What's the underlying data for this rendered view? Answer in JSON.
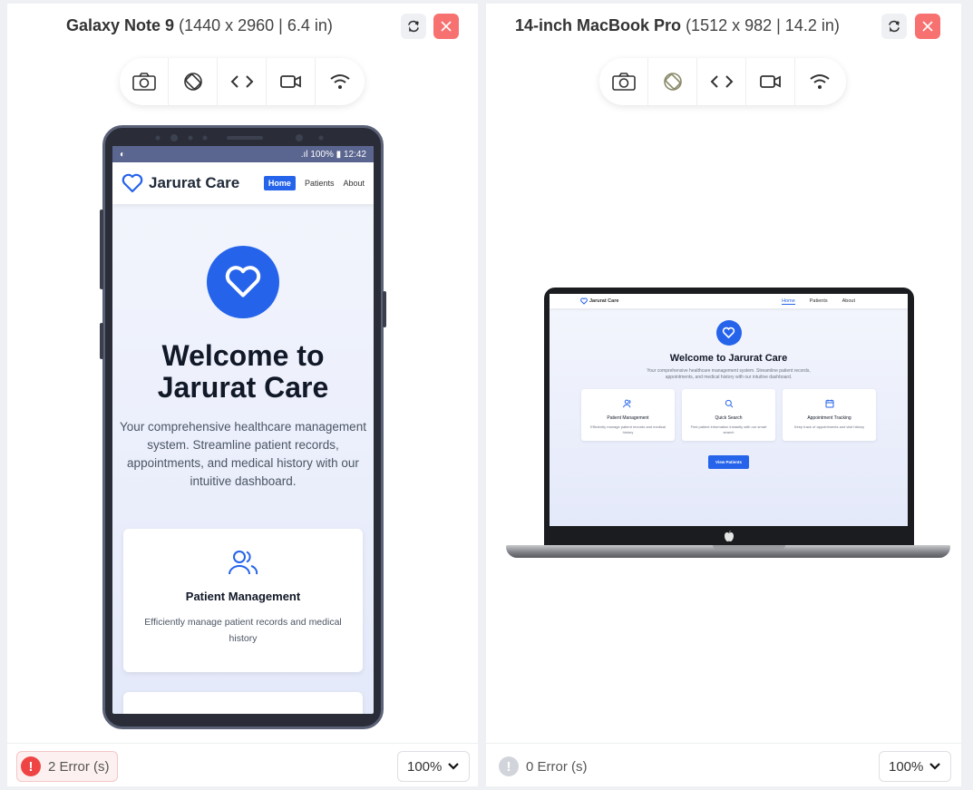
{
  "left_panel": {
    "device_name": "Galaxy Note 9",
    "device_spec": "(1440 x 2960 | 6.4 in)",
    "errors_label": "2 Error (s)",
    "zoom": "100%"
  },
  "right_panel": {
    "device_name": "14-inch MacBook Pro",
    "device_spec": "(1512 x 982 | 14.2 in)",
    "errors_label": "0 Error (s)",
    "zoom": "100%"
  },
  "toolbar_icons": [
    "camera-icon",
    "rotate-icon",
    "code-icon",
    "video-icon",
    "wifi-icon"
  ],
  "phone_status": {
    "battery": "100%",
    "time": "12:42"
  },
  "site": {
    "brand": "Jarurat Care",
    "nav": {
      "home": "Home",
      "patients": "Patients",
      "about": "About"
    },
    "hero_title": "Welcome to Jarurat Care",
    "hero_subtitle": "Your comprehensive healthcare management system. Streamline patient records, appointments, and medical history with our intuitive dashboard.",
    "features": [
      {
        "title": "Patient Management",
        "desc": "Efficiently manage patient records and medical history"
      },
      {
        "title": "Quick Search",
        "desc": "Find patient information instantly with our smart search"
      },
      {
        "title": "Appointment Tracking",
        "desc": "Keep track of appointments and visit history"
      }
    ],
    "cta": "View Patients"
  },
  "colors": {
    "accent": "#2563eb",
    "close_button": "#f87171",
    "error_red": "#ef4444",
    "error_none": "#d1d5db"
  }
}
